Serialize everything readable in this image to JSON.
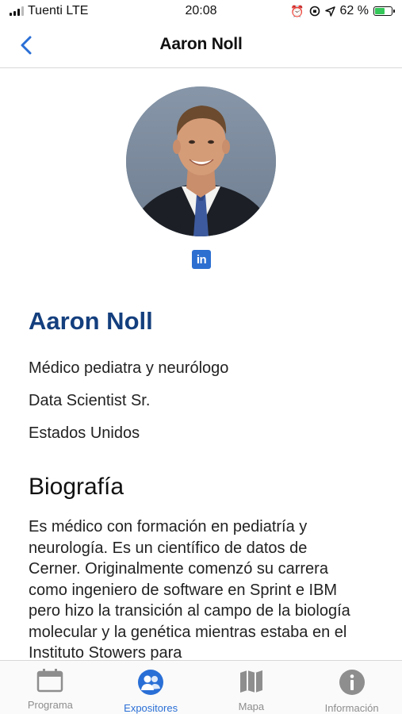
{
  "status_bar": {
    "carrier": "Tuenti LTE",
    "time": "20:08",
    "battery_percent": "62 %",
    "battery_level": 0.62,
    "icons": [
      "signal-icon",
      "alarm-icon",
      "orientation-lock-icon",
      "location-icon",
      "battery-icon"
    ]
  },
  "nav": {
    "title": "Aaron Noll",
    "back_icon": "chevron-left-icon"
  },
  "profile": {
    "name": "Aaron Noll",
    "specialty": "Médico pediatra y neurólogo",
    "role": "Data Scientist Sr.",
    "country": "Estados Unidos",
    "linkedin_label": "in"
  },
  "biography": {
    "title": "Biografía",
    "text": "Es médico con formación en pediatría y neurología. Es un científico de datos de Cerner. Originalmente comenzó su carrera como ingeniero de software en Sprint e IBM pero hizo la transición al campo de la biología molecular y la genética mientras estaba en el Instituto Stowers para"
  },
  "tabs": [
    {
      "label": "Programa",
      "icon": "calendar-icon",
      "active": false
    },
    {
      "label": "Expositores",
      "icon": "speakers-icon",
      "active": true
    },
    {
      "label": "Mapa",
      "icon": "map-icon",
      "active": false
    },
    {
      "label": "Información",
      "icon": "info-icon",
      "active": false
    }
  ],
  "colors": {
    "accent": "#2a6fd6",
    "name_color": "#143f7e",
    "linkedin": "#2c6fd1",
    "battery": "#35c759"
  }
}
